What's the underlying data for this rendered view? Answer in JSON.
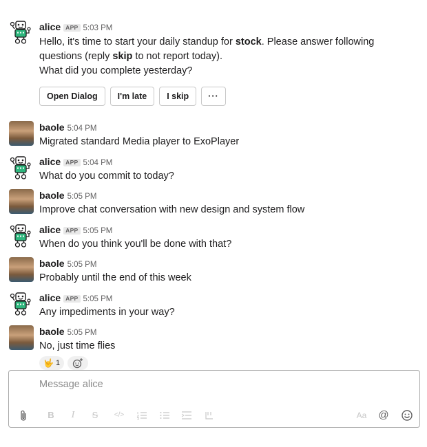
{
  "messages": [
    {
      "author": "alice",
      "badge": "APP",
      "time": "5:03 PM",
      "lines": [
        {
          "a": "Hello, it's time to start your daily standup for ",
          "b": "stock",
          "c": ". Please answer following"
        },
        {
          "a": "questions (reply ",
          "b": "skip",
          "c": " to not report today)."
        },
        {
          "a": "What did you complete yesterday?"
        }
      ],
      "buttons": [
        "Open Dialog",
        "I'm late",
        "I skip",
        "···"
      ]
    },
    {
      "author": "baole",
      "time": "5:04 PM",
      "text": "Migrated standard Media player to ExoPlayer"
    },
    {
      "author": "alice",
      "badge": "APP",
      "time": "5:04 PM",
      "text": "What do you commit to today?"
    },
    {
      "author": "baole",
      "time": "5:05 PM",
      "text": "Improve chat conversation with new design and system flow"
    },
    {
      "author": "alice",
      "badge": "APP",
      "time": "5:05 PM",
      "text": "When do you think you'll be done with that?"
    },
    {
      "author": "baole",
      "time": "5:05 PM",
      "text": "Probably until the end of this week"
    },
    {
      "author": "alice",
      "badge": "APP",
      "time": "5:05 PM",
      "text": "Any impediments in your way?"
    },
    {
      "author": "baole",
      "time": "5:05 PM",
      "text": "No, just time flies",
      "reactions": [
        {
          "emoji": "🤟",
          "count": "1"
        }
      ]
    }
  ],
  "composer": {
    "placeholder": "Message alice"
  },
  "toolbar": {
    "attach": "attach-icon",
    "bold": "B",
    "italic": "I",
    "strike": "S",
    "code": "</>",
    "format_size": "Aa",
    "mention": "@"
  },
  "colors": {
    "bot_green": "#2eb67d",
    "border": "#aaaaaa"
  }
}
